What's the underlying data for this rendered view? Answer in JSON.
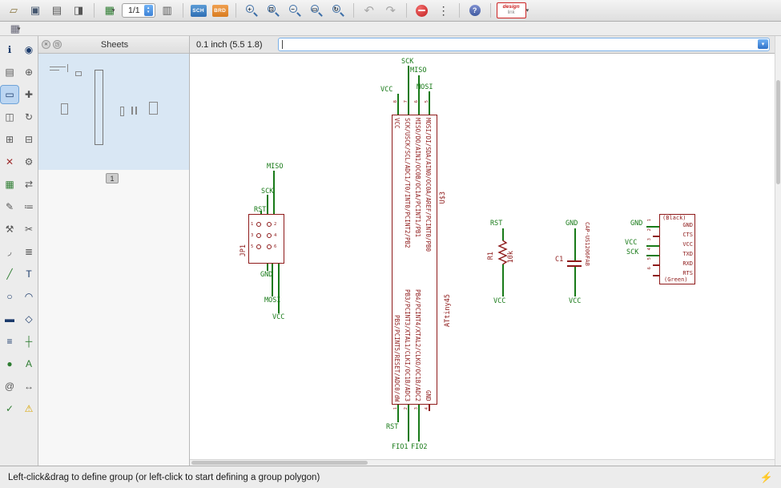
{
  "toolbar": {
    "sheet_selector": "1/1",
    "logo": {
      "line1": "design",
      "line2": "link"
    },
    "icons": {
      "open": "▱",
      "save": "▣",
      "print": "▤",
      "export_image": "◨",
      "grid": "▦",
      "grid_small": "▦",
      "table": "▥",
      "sch_label": "SCH",
      "brd_label": "BRD",
      "zoom_in": "+",
      "zoom_fit": "⊡",
      "zoom_out": "−",
      "zoom_select": "▭",
      "zoom_redraw": "↻",
      "undo": "↶",
      "redo": "↷",
      "dots": "⋮",
      "help": "?",
      "caret": "▾",
      "up": "▴",
      "down": "▾"
    }
  },
  "sheets": {
    "title": "Sheets",
    "page_label": "1",
    "close_glyph": "✕",
    "detach_glyph": "◳"
  },
  "coord_bar": {
    "coordinates": "0.1 inch (5.5 1.8)"
  },
  "left_tools": [
    {
      "name": "info-tool",
      "glyph": "ℹ",
      "color": "#1a3a6b"
    },
    {
      "name": "show-tool",
      "glyph": "◉",
      "color": "#1a3a6b"
    },
    {
      "name": "display-tool",
      "glyph": "▤",
      "color": "#555555"
    },
    {
      "name": "mark-tool",
      "glyph": "⊕",
      "color": "#555555"
    },
    {
      "name": "group-tool",
      "glyph": "▭",
      "color": "#1a3a6b",
      "active": true
    },
    {
      "name": "move-tool",
      "glyph": "✚",
      "color": "#555555"
    },
    {
      "name": "mirror-tool",
      "glyph": "◫",
      "color": "#555555"
    },
    {
      "name": "rotate-tool",
      "glyph": "↻",
      "color": "#555555"
    },
    {
      "name": "copy-tool",
      "glyph": "⊞",
      "color": "#555555"
    },
    {
      "name": "paste-tool",
      "glyph": "⊟",
      "color": "#555555"
    },
    {
      "name": "delete-tool",
      "glyph": "✕",
      "color": "#a03030"
    },
    {
      "name": "change-tool",
      "glyph": "⚙",
      "color": "#555555"
    },
    {
      "name": "add-part-tool",
      "glyph": "▦",
      "color": "#2e7d32"
    },
    {
      "name": "pinswap-tool",
      "glyph": "⇄",
      "color": "#555555"
    },
    {
      "name": "name-tool",
      "glyph": "✎",
      "color": "#555555"
    },
    {
      "name": "value-tool",
      "glyph": "≔",
      "color": "#555555"
    },
    {
      "name": "smash-tool",
      "glyph": "⚒",
      "color": "#555555"
    },
    {
      "name": "split-tool",
      "glyph": "✂",
      "color": "#555555"
    },
    {
      "name": "miter-tool",
      "glyph": "◞",
      "color": "#555555"
    },
    {
      "name": "invoke-tool",
      "glyph": "≣",
      "color": "#555555"
    },
    {
      "name": "wire-tool",
      "glyph": "╱",
      "color": "#2e7d32"
    },
    {
      "name": "text-tool",
      "glyph": "T",
      "color": "#1a3a6b"
    },
    {
      "name": "circle-tool",
      "glyph": "○",
      "color": "#1a3a6b"
    },
    {
      "name": "arc-tool",
      "glyph": "◠",
      "color": "#1a3a6b"
    },
    {
      "name": "rect-tool",
      "glyph": "▬",
      "color": "#1a3a6b"
    },
    {
      "name": "polygon-tool",
      "glyph": "◇",
      "color": "#1a3a6b"
    },
    {
      "name": "bus-tool",
      "glyph": "≡",
      "color": "#1a3a6b"
    },
    {
      "name": "net-tool",
      "glyph": "┼",
      "color": "#2e7d32"
    },
    {
      "name": "junction-tool",
      "glyph": "●",
      "color": "#2e7d32"
    },
    {
      "name": "label-tool",
      "glyph": "A",
      "color": "#2e7d32"
    },
    {
      "name": "attribute-tool",
      "glyph": "@",
      "color": "#555555"
    },
    {
      "name": "dimension-tool",
      "glyph": "↔",
      "color": "#555555"
    },
    {
      "name": "erc-tool",
      "glyph": "✓",
      "color": "#2e7d32"
    },
    {
      "name": "errors-tool",
      "glyph": "⚠",
      "color": "#d9a400"
    }
  ],
  "schematic": {
    "colors": {
      "part": "#8e1a1a",
      "net": "#187a18"
    },
    "jp1": {
      "ref": "JP1",
      "nets_top": [
        "MISO",
        "SCK",
        "RST"
      ],
      "nets_bottom": [
        "GND",
        "MOSI",
        "VCC"
      ],
      "pin_numbers": [
        "1",
        "2",
        "3",
        "4",
        "5",
        "6"
      ]
    },
    "u3": {
      "ref": "U$3",
      "value": "ATtiny45",
      "top_pin_numbers": [
        "8",
        "7",
        "6",
        "5"
      ],
      "bottom_pin_numbers": [
        "1",
        "2",
        "3",
        "4"
      ],
      "top_pin_names": [
        "VCC",
        "SCK/USCK/SCL/ADC1/T0/INT0/PCINT2/PB2",
        "MISO/DO/AIN1/OC0B/OC1A/PCINT1/PB1",
        "MOSI/DI/SDA/AIN0/OC0A/AREF/PCINT0/PB0"
      ],
      "bottom_pin_names": [
        "PB5/PCINT5/RESET/ADC0/dW",
        "PB3/PCINT3/XTAL1/CLKI/OC1B/ADC3",
        "PB4/PCINT4/XTAL2/CLKO/OC1B/ADC2",
        "GND"
      ],
      "nets_top": [
        "VCC",
        "SCK",
        "MISO",
        "MOSI"
      ],
      "nets_bottom": [
        "RST",
        "FIO1",
        "FIO2"
      ]
    },
    "r1": {
      "ref": "R1",
      "value": "10k",
      "net_top": "RST",
      "net_bottom": "VCC"
    },
    "c1": {
      "ref": "C1",
      "value": "CAP-US1206FAB",
      "net_top": "GND",
      "net_bottom": "VCC"
    },
    "serial": {
      "top_note": "(Black)",
      "bottom_note": "(Green)",
      "pin_labels": [
        "GND",
        "CTS",
        "VCC",
        "TXD",
        "RXD",
        "RTS"
      ],
      "pin_numbers": [
        "1",
        "2",
        "3",
        "4",
        "5",
        "6"
      ],
      "nets": [
        "GND",
        "VCC",
        "SCK"
      ]
    }
  },
  "status_bar": {
    "message": "Left-click&drag to define group (or left-click to start defining a group polygon)",
    "bolt": "⚡"
  }
}
